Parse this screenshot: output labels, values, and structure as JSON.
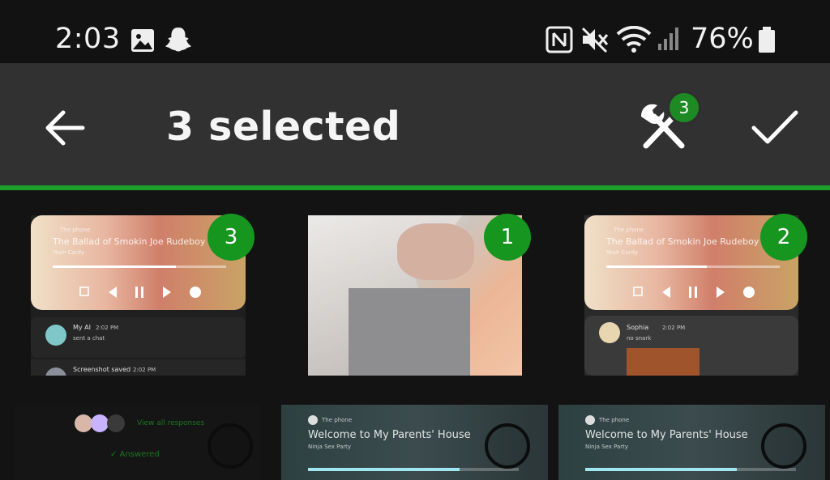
{
  "status_bar": {
    "time": "2:03",
    "battery_percent": "76%",
    "icons": [
      "image-icon",
      "snapchat-icon",
      "nfc-icon",
      "mute-icon",
      "wifi-icon",
      "signal-icon",
      "battery-icon"
    ]
  },
  "app_bar": {
    "title": "3 selected",
    "tools_badge_count": "3",
    "icons": [
      "back-arrow-icon",
      "tools-icon",
      "check-icon"
    ]
  },
  "colors": {
    "accent": "#1e9e2a",
    "app_bar": "#313131",
    "background": "#131313"
  },
  "grid": {
    "row1": [
      {
        "kind": "screenshot",
        "selection_order": "3",
        "player_title": "The Ballad of Smokin Joe Rudeboy",
        "player_source": "The phone",
        "player_artist": "Yeah Cardy",
        "notif1_name": "My AI",
        "notif1_time": "2:02 PM",
        "notif1_text": "sent a chat",
        "notif2_name": "Screenshot saved",
        "notif2_time": "2:02 PM"
      },
      {
        "kind": "photo",
        "selection_order": "1"
      },
      {
        "kind": "screenshot",
        "selection_order": "2",
        "player_title": "The Ballad of Smokin Joe Rudeboy",
        "player_source": "The phone",
        "player_artist": "Yeah Cardy",
        "notif1_name": "Sophia",
        "notif1_time": "2:02 PM",
        "notif1_text": "no snark"
      }
    ],
    "row2": [
      {
        "kind": "screenshot",
        "link_text": "View all responses",
        "status_text": "✓ Answered"
      },
      {
        "kind": "screenshot",
        "player_source": "The phone",
        "player_title": "Welcome to My Parents' House",
        "player_artist": "Ninja Sex Party"
      },
      {
        "kind": "screenshot",
        "player_source": "The phone",
        "player_title": "Welcome to My Parents' House",
        "player_artist": "Ninja Sex Party"
      }
    ]
  }
}
